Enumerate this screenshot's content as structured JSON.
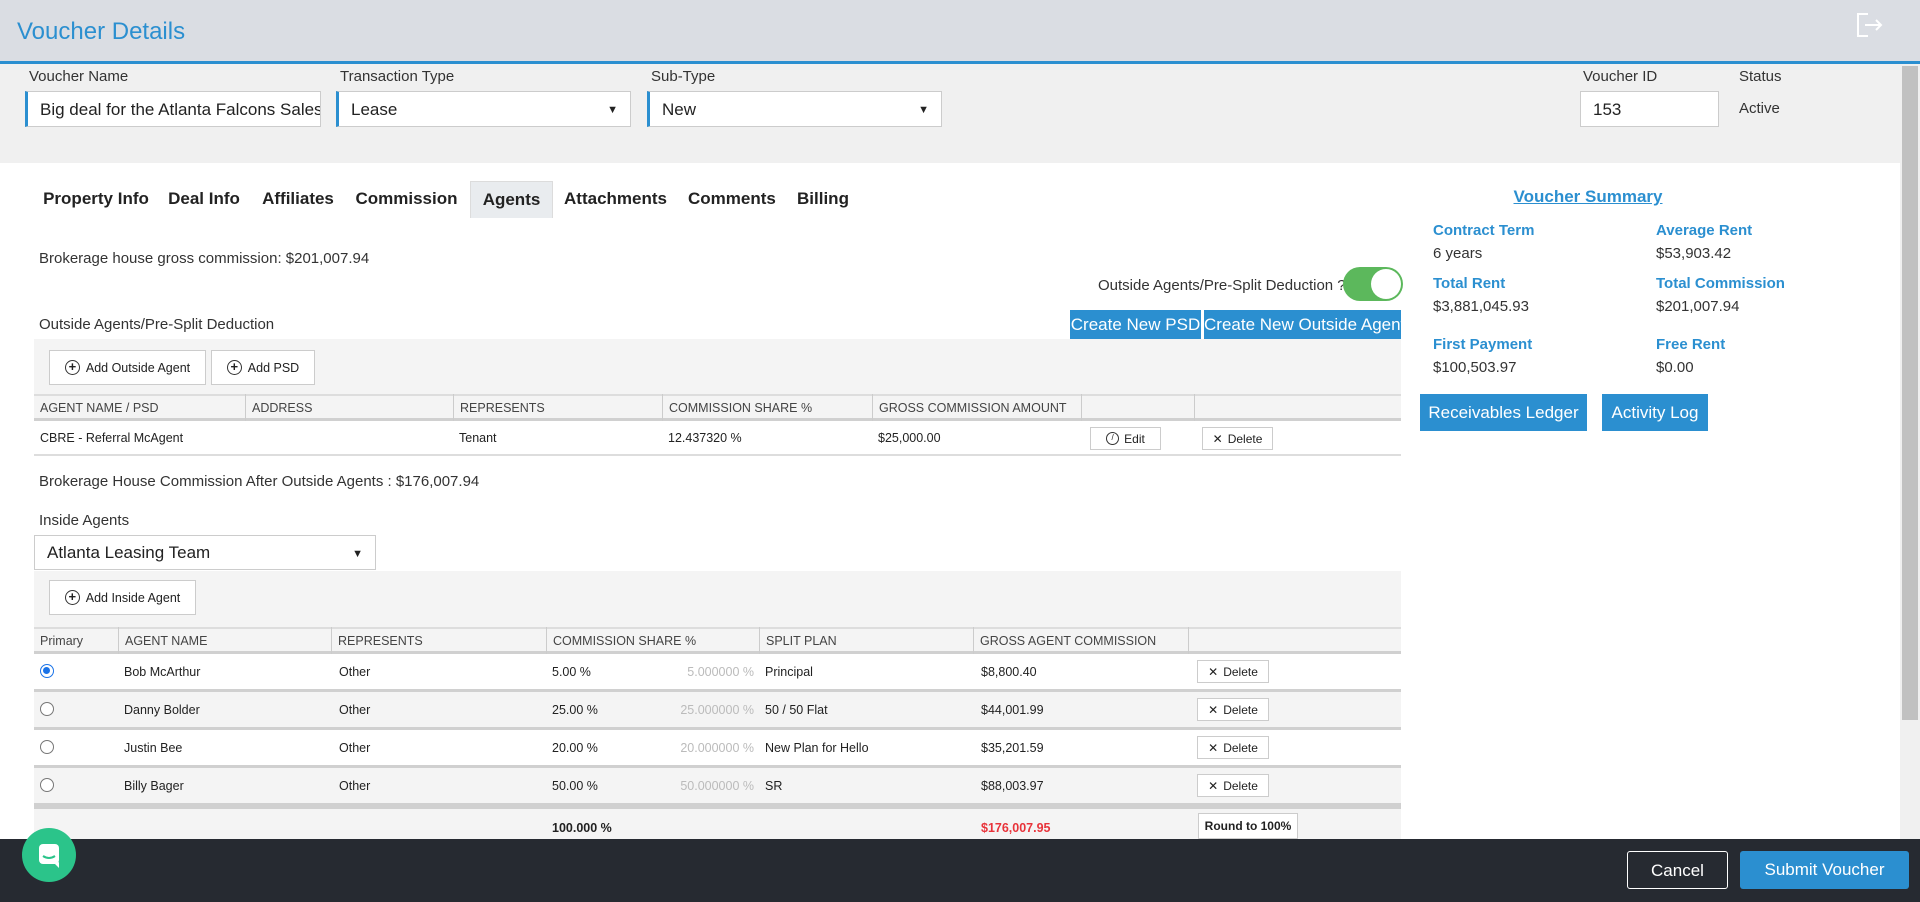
{
  "header": {
    "title": "Voucher Details",
    "exit_icon": "sign-out-icon"
  },
  "form": {
    "voucher_name": {
      "label": "Voucher Name",
      "value": "Big deal for the Atlanta Falcons Sales T"
    },
    "transaction_type": {
      "label": "Transaction Type",
      "value": "Lease"
    },
    "sub_type": {
      "label": "Sub-Type",
      "value": "New"
    },
    "voucher_id": {
      "label": "Voucher ID",
      "value": "153"
    },
    "status": {
      "label": "Status",
      "value": "Active"
    }
  },
  "tabs": [
    {
      "label": "Property Info"
    },
    {
      "label": "Deal Info"
    },
    {
      "label": "Affiliates"
    },
    {
      "label": "Commission"
    },
    {
      "label": "Agents",
      "active": true
    },
    {
      "label": "Attachments"
    },
    {
      "label": "Comments"
    },
    {
      "label": "Billing"
    }
  ],
  "agents": {
    "gross_commission": "Brokerage house gross commission: $201,007.94",
    "toggle_label": "Outside Agents/Pre-Split Deduction ?",
    "toggle_on": true,
    "outside_title": "Outside Agents/Pre-Split Deduction",
    "create_psd": "Create New PSD",
    "create_outside_agent": "Create New Outside Agent",
    "add_outside_agent": "Add Outside Agent",
    "add_psd": "Add PSD",
    "outside_columns": [
      "AGENT NAME / PSD",
      "ADDRESS",
      "REPRESENTS",
      "COMMISSION SHARE %",
      "GROSS COMMISSION AMOUNT",
      "",
      ""
    ],
    "outside_rows": [
      {
        "name": "CBRE - Referral McAgent",
        "address": "",
        "represents": "Tenant",
        "share": "12.437320 %",
        "amount": "$25,000.00",
        "edit": "Edit",
        "delete": "Delete"
      }
    ],
    "after_outside": "Brokerage House Commission After Outside Agents : $176,007.94",
    "inside_label": "Inside Agents",
    "inside_team": "Atlanta Leasing Team",
    "add_inside_agent": "Add Inside Agent",
    "inside_columns": [
      "Primary",
      "AGENT NAME",
      "REPRESENTS",
      "COMMISSION SHARE %",
      "SPLIT PLAN",
      "GROSS AGENT COMMISSION",
      ""
    ],
    "inside_rows": [
      {
        "primary": true,
        "name": "Bob McArthur",
        "represents": "Other",
        "share": "5.00 %",
        "share_precise": "5.000000 %",
        "plan": "Principal",
        "commission": "$8,800.40",
        "delete": "Delete"
      },
      {
        "primary": false,
        "name": "Danny Bolder",
        "represents": "Other",
        "share": "25.00 %",
        "share_precise": "25.000000 %",
        "plan": "50 / 50 Flat",
        "commission": "$44,001.99",
        "delete": "Delete"
      },
      {
        "primary": false,
        "name": "Justin Bee",
        "represents": "Other",
        "share": "20.00 %",
        "share_precise": "20.000000 %",
        "plan": "New Plan for Hello",
        "commission": "$35,201.59",
        "delete": "Delete"
      },
      {
        "primary": false,
        "name": "Billy Bager",
        "represents": "Other",
        "share": "50.00 %",
        "share_precise": "50.000000 %",
        "plan": "SR",
        "commission": "$88,003.97",
        "delete": "Delete"
      }
    ],
    "total_share": "100.000 %",
    "total_commission": "$176,007.95",
    "total_commission_color": "#e8333a",
    "round_button": "Round to 100%"
  },
  "summary": {
    "title": "Voucher Summary",
    "items": [
      {
        "label": "Contract Term",
        "value": "6 years"
      },
      {
        "label": "Average Rent",
        "value": "$53,903.42"
      },
      {
        "label": "Total Rent",
        "value": "$3,881,045.93"
      },
      {
        "label": "Total Commission",
        "value": "$201,007.94"
      },
      {
        "label": "First Payment",
        "value": "$100,503.97"
      },
      {
        "label": "Free Rent",
        "value": "$0.00"
      }
    ],
    "receivables_ledger": "Receivables Ledger",
    "activity_log": "Activity Log"
  },
  "footer": {
    "cancel": "Cancel",
    "submit": "Submit Voucher",
    "chat_icon": "chat-icon"
  },
  "colors": {
    "accent": "#2b8fd0",
    "toggle": "#5cb85c",
    "footer": "#262a31",
    "chat": "#2bc48a"
  }
}
